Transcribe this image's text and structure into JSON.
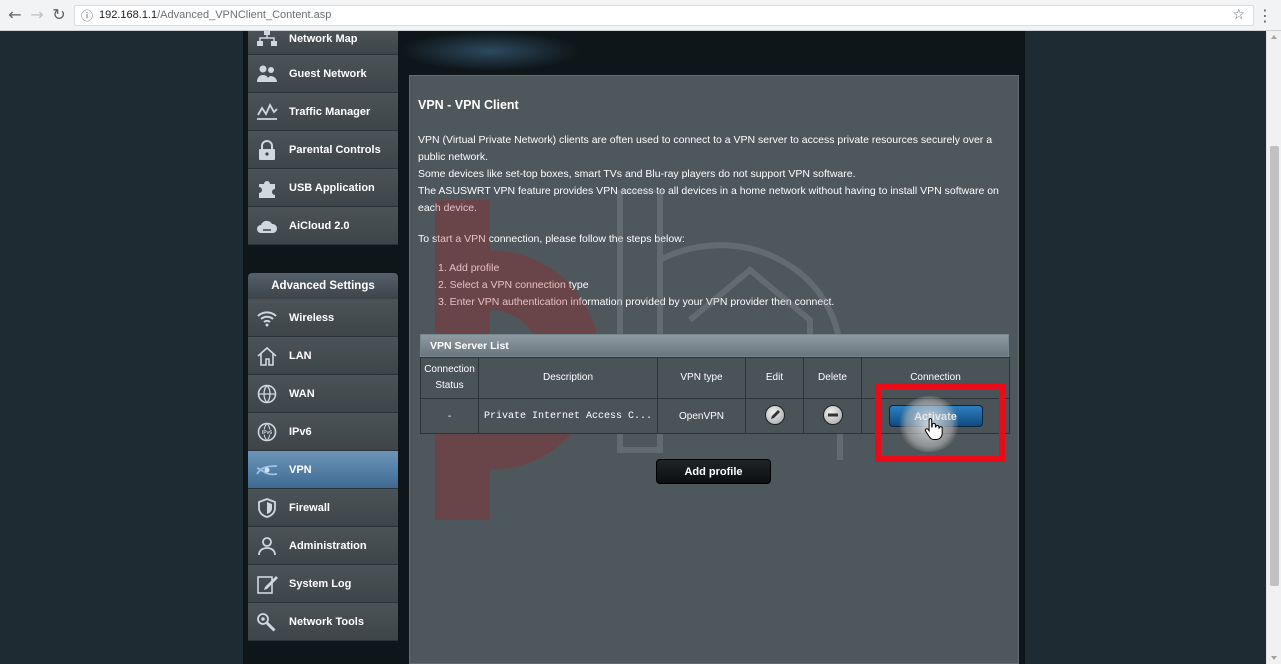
{
  "browser": {
    "url_host": "192.168.1.1",
    "url_path": "/Advanced_VPNClient_Content.asp",
    "icons": [
      "back-arrow-icon",
      "forward-arrow-icon",
      "reload-icon",
      "info-icon",
      "star-icon",
      "menu-dots-icon"
    ]
  },
  "sidebar": {
    "general_items": [
      {
        "label": "Network Map",
        "icon": "network-map-icon"
      },
      {
        "label": "Guest Network",
        "icon": "guest-network-icon"
      },
      {
        "label": "Traffic Manager",
        "icon": "traffic-manager-icon"
      },
      {
        "label": "Parental Controls",
        "icon": "lock-icon"
      },
      {
        "label": "USB Application",
        "icon": "puzzle-icon"
      },
      {
        "label": "AiCloud 2.0",
        "icon": "cloud-icon"
      }
    ],
    "advanced_title": "Advanced Settings",
    "advanced_items": [
      {
        "label": "Wireless",
        "icon": "wifi-icon"
      },
      {
        "label": "LAN",
        "icon": "house-icon"
      },
      {
        "label": "WAN",
        "icon": "globe-icon"
      },
      {
        "label": "IPv6",
        "icon": "ipv6-globe-icon"
      },
      {
        "label": "VPN",
        "icon": "vpn-icon",
        "active": true
      },
      {
        "label": "Firewall",
        "icon": "shield-icon"
      },
      {
        "label": "Administration",
        "icon": "person-icon"
      },
      {
        "label": "System Log",
        "icon": "log-icon"
      },
      {
        "label": "Network Tools",
        "icon": "tools-icon"
      }
    ]
  },
  "content": {
    "title": "VPN - VPN Client",
    "description": [
      "VPN (Virtual Private Network) clients are often used to connect to a VPN server to access private resources securely over a public network.",
      "Some devices like set-top boxes, smart TVs and Blu-ray players do not support VPN software.",
      "The ASUSWRT VPN feature provides VPN access to all devices in a home network without having to install VPN software on each device."
    ],
    "steps_intro": "To start a VPN connection, please follow the steps below:",
    "steps": [
      "1. Add profile",
      "2. Select a VPN connection type",
      "3. Enter VPN authentication information provided by your VPN provider then connect."
    ]
  },
  "table": {
    "title": "VPN Server List",
    "columns": {
      "status_line1": "Connection",
      "status_line2": "Status",
      "description": "Description",
      "type": "VPN type",
      "edit": "Edit",
      "delete": "Delete",
      "connection": "Connection"
    },
    "rows": [
      {
        "status": "-",
        "description": "Private Internet Access C...",
        "type": "OpenVPN",
        "edit_icon": "edit-pencil-icon",
        "delete_icon": "minus-circle-icon",
        "action": "Activate"
      }
    ]
  },
  "add_profile_label": "Add profile",
  "colors": {
    "highlight": "#ea0a18",
    "activate_button": "#1f6aa8",
    "active_nav": "#4f7ba3",
    "panel": "#4e575c"
  }
}
